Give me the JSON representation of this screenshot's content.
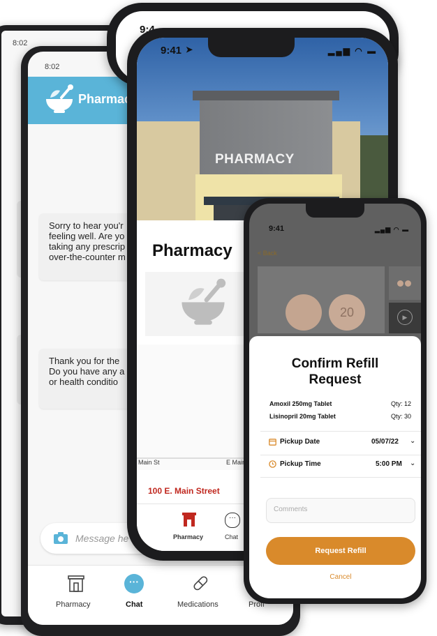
{
  "chat_app": {
    "time_back": "8:02",
    "time_front": "8:02",
    "header_title": "Pharmacy",
    "bubble_1": [
      "Sorry to hear you'r",
      "feeling well. Are yo",
      "taking any prescrip",
      "over-the-counter m"
    ],
    "bubble_2": [
      "Thank you for the",
      "Do you have any a",
      "or health conditio"
    ],
    "message_placeholder": "Message he",
    "tabs": {
      "pharmacy": "Pharmacy",
      "chat": "Chat",
      "medications": "Medications",
      "profile": "Profi"
    },
    "brand_color": "#5ab4d8"
  },
  "top_phone": {
    "time": "9:4"
  },
  "pharmacy_app": {
    "time": "9:41",
    "sign_text": "PHARMACY",
    "title": "Pharmacy",
    "map_labels": {
      "left": "Main St",
      "right": "E Main"
    },
    "address": "100 E. Main Street",
    "tabs": {
      "pharmacy": "Pharmacy",
      "chat": "Chat"
    },
    "accent_color": "#c0281f"
  },
  "refill_app": {
    "time": "9:41",
    "back_label": "< Back",
    "pill_imprint": "20",
    "sheet_title_line1": "Confirm Refill",
    "sheet_title_line2": "Request",
    "medications": [
      {
        "name": "Amoxil 250mg Tablet",
        "qty": "Qty: 12"
      },
      {
        "name": "Lisinopril 20mg Tablet",
        "qty": "Qty: 30"
      }
    ],
    "pickup_date_label": "Pickup Date",
    "pickup_date_value": "05/07/22",
    "pickup_time_label": "Pickup Time",
    "pickup_time_value": "5:00 PM",
    "comments_placeholder": "Comments",
    "request_button": "Request Refill",
    "cancel": "Cancel",
    "accent_color": "#d98a2b"
  }
}
